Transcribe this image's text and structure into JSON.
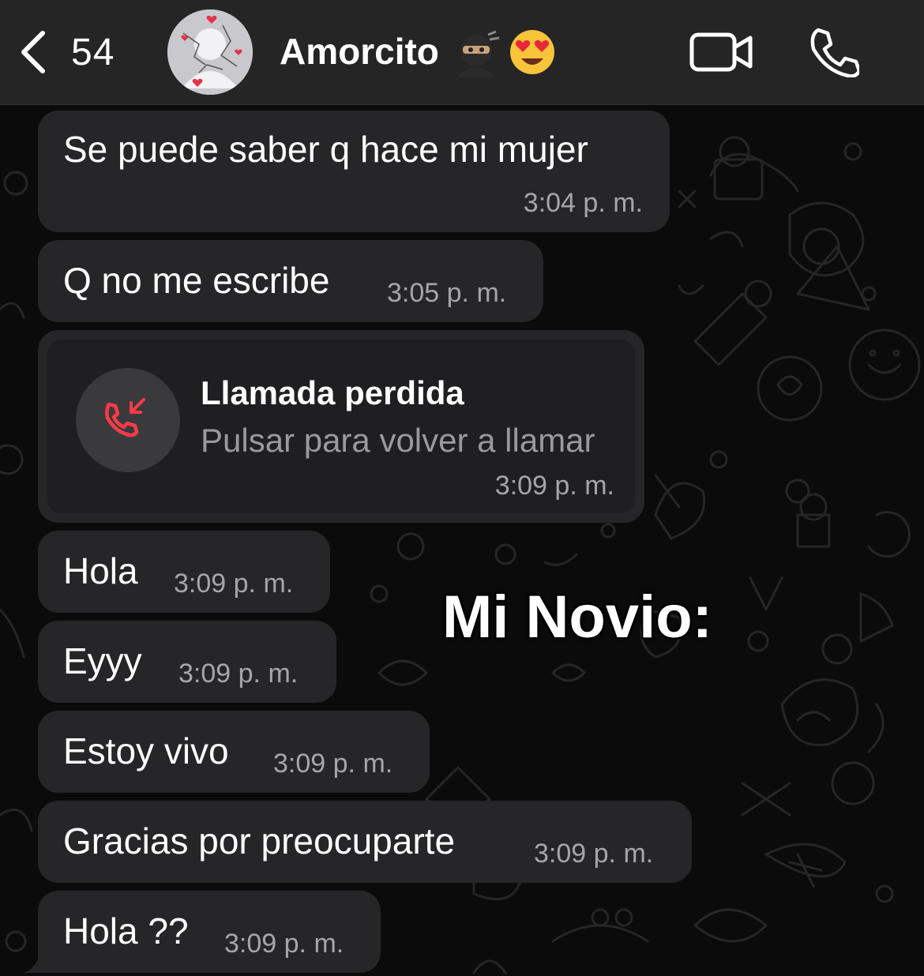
{
  "header": {
    "back_count": "54",
    "contact_name": "Amorcito",
    "avatar_icon": "default-avatar-with-hearts",
    "video_icon": "video-camera-icon",
    "phone_icon": "phone-icon"
  },
  "colors": {
    "header_bg": "#252525",
    "bubble_bg": "#262628",
    "missed_call_red": "#ff3b4a",
    "timestamp": "#a6a6aa"
  },
  "messages": [
    {
      "text": "Se puede saber q hace mi mujer",
      "time": "3:04",
      "suffix": "p. m."
    },
    {
      "text": "Q no me escribe",
      "time": "3:05",
      "suffix": "p. m."
    },
    {
      "text": "Hola",
      "time": "3:09",
      "suffix": "p. m."
    },
    {
      "text": "Eyyy",
      "time": "3:09",
      "suffix": "p. m."
    },
    {
      "text": "Estoy vivo",
      "time": "3:09",
      "suffix": "p. m."
    },
    {
      "text": "Gracias por preocuparte",
      "time": "3:09",
      "suffix": "p. m."
    },
    {
      "text": "Hola ??",
      "time": "3:09",
      "suffix": "p. m."
    }
  ],
  "missed_call": {
    "title": "Llamada perdida",
    "subtitle": "Pulsar para volver a llamar",
    "time": "3:09",
    "suffix": "p. m."
  },
  "overlay_caption": "Mi Novio:"
}
